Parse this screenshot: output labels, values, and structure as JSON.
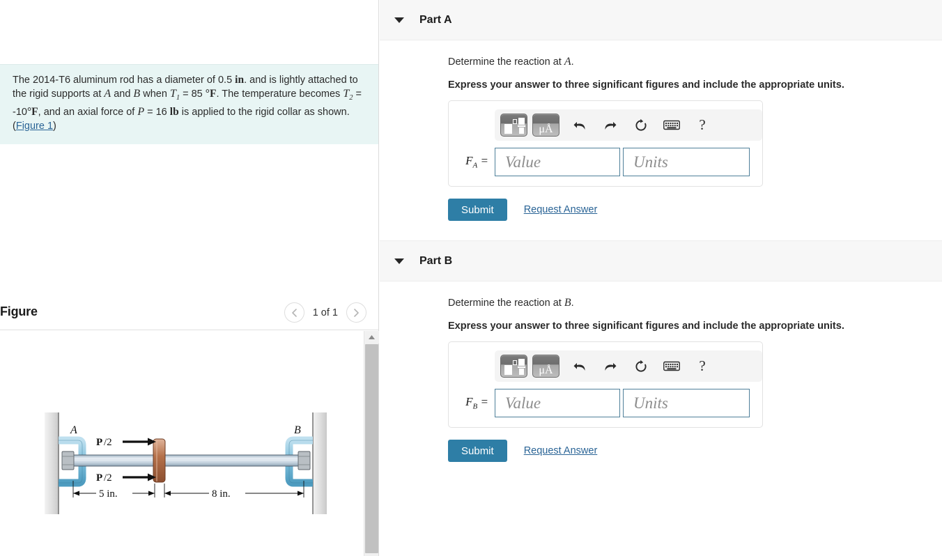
{
  "problem": {
    "line1_a": "The 2014-T6 aluminum rod has a diameter of 0.5 ",
    "unit_in": "in",
    "line1_b": ". and is lightly",
    "line2_a": "attached to the rigid supports at ",
    "var_A": "A",
    "line2_b": " and ",
    "var_B": "B",
    "line2_c": " when ",
    "var_T1": "T",
    "sub_1": "1",
    "line2_d": " = 85 ",
    "unit_degF1": "°F",
    "line2_e": ". The",
    "line3_a": "temperature becomes ",
    "var_T2": "T",
    "sub_2": "2",
    "line3_b": " = -10",
    "unit_degF2": "°F",
    "line3_c": ", and an axial force of ",
    "var_P": "P",
    "line3_d": " = 16 ",
    "unit_lb": "lb",
    "line3_e": " is",
    "line4": "applied to the rigid collar as shown.",
    "figure_link_open": "(",
    "figure_link": "Figure 1",
    "figure_link_close": ")"
  },
  "figure": {
    "title": "Figure",
    "counter": "1 of 1",
    "prev_icon": "chevron-left-icon",
    "next_icon": "chevron-right-icon",
    "diagram": {
      "label_A": "A",
      "label_B": "B",
      "force_top": "P/2",
      "force_bottom": "P/2",
      "dim_left": "5 in.",
      "dim_right": "8 in.",
      "colors": {
        "support": "#6fb6d4",
        "rod": "#c8d6e0",
        "collar": "#b5714a",
        "wall": "#d9d9d9"
      }
    }
  },
  "toolbar": {
    "template_icon": "math-template-icon",
    "units_glyph": "μÅ",
    "undo_icon": "undo-icon",
    "redo_icon": "redo-icon",
    "reset_icon": "reset-icon",
    "keyboard_icon": "keyboard-icon",
    "help_glyph": "?"
  },
  "parts": [
    {
      "id": "part-a",
      "label": "Part A",
      "prompt_pre": "Determine the reaction at ",
      "prompt_var": "A",
      "prompt_post": ".",
      "instruction": "Express your answer to three significant figures and include the appropriate units.",
      "var_name": "F",
      "var_sub": "A",
      "var_eq": " =",
      "value_placeholder": "Value",
      "units_placeholder": "Units",
      "value_current": "",
      "units_current": "",
      "submit_label": "Submit",
      "request_label": "Request Answer",
      "expanded": true
    },
    {
      "id": "part-b",
      "label": "Part B",
      "prompt_pre": "Determine the reaction at ",
      "prompt_var": "B",
      "prompt_post": ".",
      "instruction": "Express your answer to three significant figures and include the appropriate units.",
      "var_name": "F",
      "var_sub": "B",
      "var_eq": " =",
      "value_placeholder": "Value",
      "units_placeholder": "Units",
      "value_current": "",
      "units_current": "",
      "submit_label": "Submit",
      "request_label": "Request Answer",
      "expanded": true
    }
  ],
  "colors": {
    "problem_bg": "#e8f5f4",
    "header_bg": "#f7f7f7",
    "submit_blue": "#2e7ea6",
    "link_blue": "#2a6496",
    "field_border": "#4e7f99"
  }
}
